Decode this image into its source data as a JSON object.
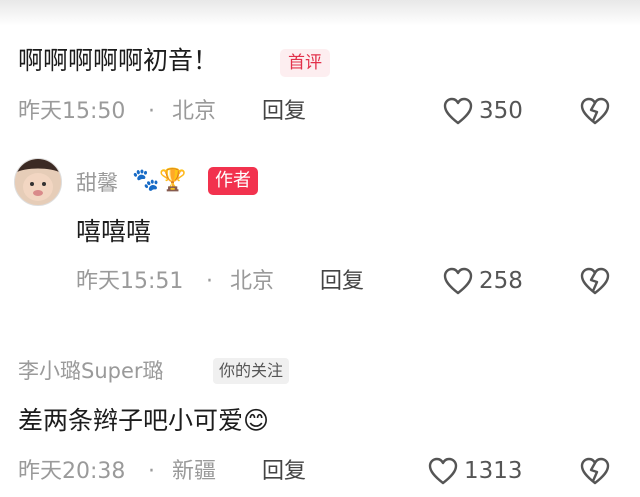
{
  "comments": [
    {
      "text": "啊啊啊啊啊初音！",
      "badge": "首评",
      "time": "昨天15:50",
      "sep": "·",
      "location": "北京",
      "reply_label": "回复",
      "likes": "350"
    },
    {
      "username": "甜馨",
      "user_emojis": "🐾🏆",
      "badge": "作者",
      "text": "嘻嘻嘻",
      "time": "昨天15:51",
      "sep": "·",
      "location": "北京",
      "reply_label": "回复",
      "likes": "258"
    },
    {
      "username": "李小璐Super璐",
      "badge": "你的关注",
      "text": "差两条辫子吧小可爱😊",
      "time": "昨天20:38",
      "sep": "·",
      "location": "新疆",
      "reply_label": "回复",
      "likes": "1313"
    }
  ],
  "icons": {
    "like": "heart-outline-icon",
    "dislike": "broken-heart-icon"
  },
  "colors": {
    "accent": "#f2324e",
    "meta_gray": "#9a9a9a"
  }
}
